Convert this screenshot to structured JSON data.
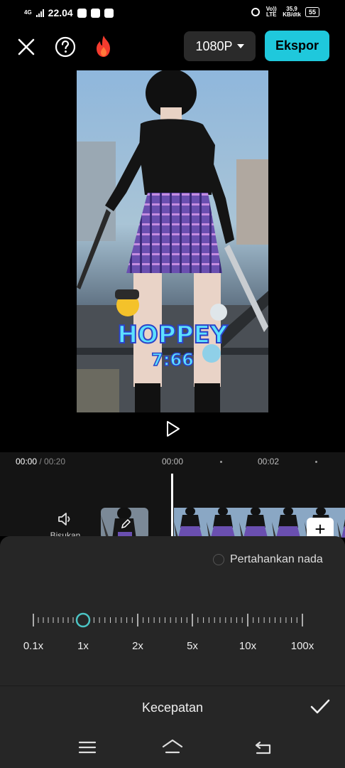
{
  "status_bar": {
    "network": "4G",
    "time": "22.04",
    "lte_label": "Vo)) LTE",
    "speed_value": "35,9",
    "speed_unit": "KB/dtk",
    "battery": "55"
  },
  "toolbar": {
    "close_icon": "close-icon",
    "help_icon": "help-icon",
    "fire_icon": "fire-icon",
    "resolution": "1080P",
    "export_label": "Ekspor",
    "export_color": "#1fc8dc"
  },
  "preview": {
    "sticker_text_line1": "HOPPEY",
    "sticker_text_line2": "7:66"
  },
  "timeline": {
    "current_time": "00:00",
    "total_time": "/ 00:20",
    "ruler_labels": [
      "00:00",
      "00:02"
    ],
    "audio_label": "Bisukan"
  },
  "speed_panel": {
    "keep_pitch_label": "Pertahankan nada",
    "keep_pitch_checked": false,
    "speed_options": [
      "0.1x",
      "1x",
      "2x",
      "5x",
      "10x",
      "100x"
    ],
    "selected_speed": "1x",
    "accent_color": "#4bc4c4"
  },
  "bottom_bar": {
    "title": "Kecepatan"
  },
  "nav_bar": {
    "icons": [
      "menu-icon",
      "home-icon",
      "back-icon"
    ]
  }
}
